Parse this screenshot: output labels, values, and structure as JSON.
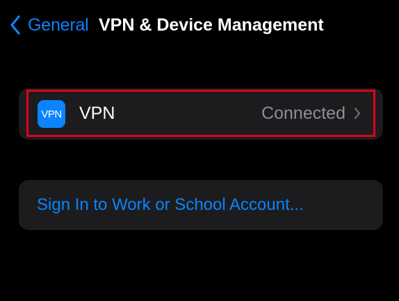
{
  "nav": {
    "back_label": "General",
    "title": "VPN & Device Management"
  },
  "vpn_row": {
    "icon_text": "VPN",
    "label": "VPN",
    "status": "Connected"
  },
  "account_row": {
    "label": "Sign In to Work or School Account..."
  },
  "colors": {
    "background": "#000000",
    "group_background": "#1c1c1e",
    "accent": "#0a84ff",
    "secondary_text": "#8e8e93",
    "highlight_border": "#e0001b"
  }
}
